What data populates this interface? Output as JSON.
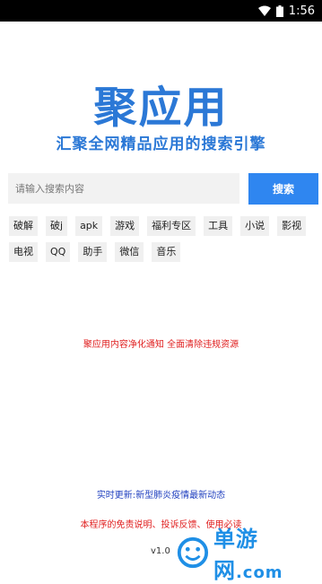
{
  "status_bar": {
    "time": "1:56"
  },
  "logo": {
    "title": "聚应用"
  },
  "slogan": "汇聚全网精品应用的搜索引擎",
  "search": {
    "placeholder": "请输入搜索内容",
    "button_label": "搜索"
  },
  "tags": {
    "row1": [
      "破解",
      "破j",
      "apk",
      "游戏",
      "福利专区",
      "工具",
      "小说",
      "影视"
    ],
    "row2": [
      "电视",
      "QQ",
      "助手",
      "微信",
      "音乐"
    ]
  },
  "notice": "聚应用内容净化通知 全面清除违规资源",
  "update": "实时更新:新型肺炎疫情最新动态",
  "disclaimer": "本程序的免责说明、投诉反馈、使用必读",
  "version": "v1.0",
  "watermark": {
    "text": "单游网",
    "suffix": ".com"
  },
  "colors": {
    "brand_blue": "#2b78d6",
    "button_blue": "#2f86f0",
    "notice_red": "#e02020",
    "update_blue": "#1f3fbf"
  }
}
